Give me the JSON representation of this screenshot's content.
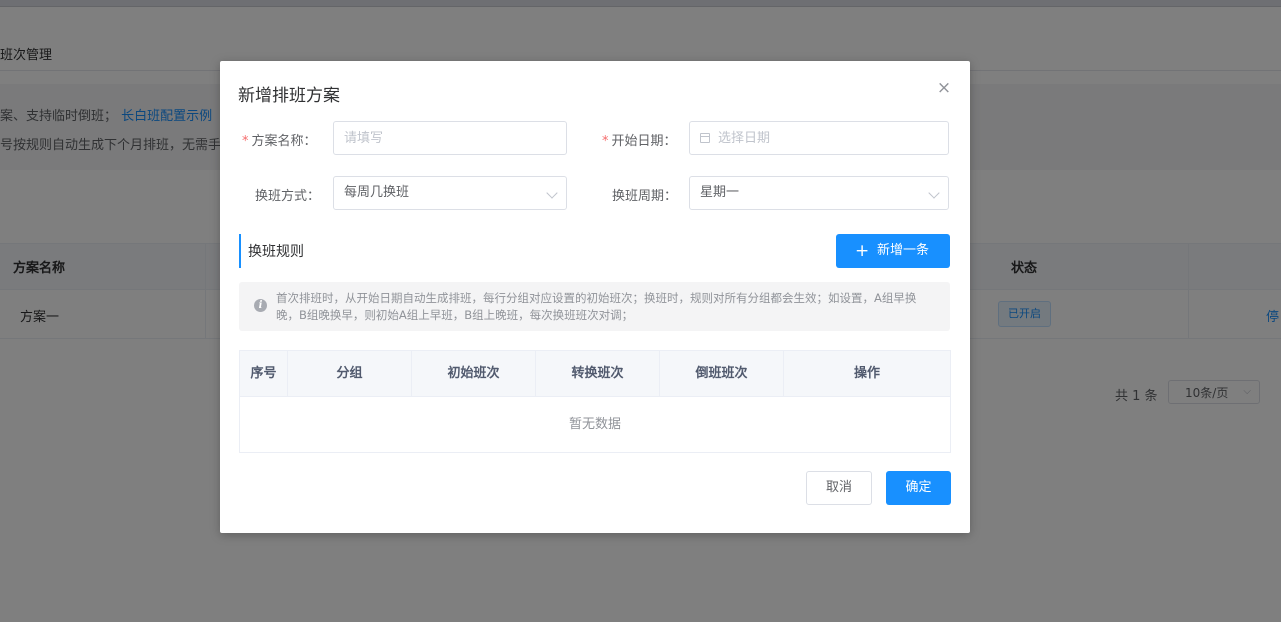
{
  "background": {
    "page_title": "班次管理",
    "tip": {
      "line1_prefix": "案、支持临时倒班；",
      "link": "长白班配置示例",
      "line2": "号按规则自动生成下个月排班，无需手"
    },
    "table": {
      "headers": [
        "方案名称",
        "状态"
      ],
      "rows": [
        {
          "name": "方案一",
          "status": "已开启",
          "action": "停"
        }
      ]
    },
    "pagination": {
      "total": "共 1 条",
      "page_size": "10条/页"
    }
  },
  "dialog": {
    "title": "新增排班方案",
    "close_icon": "close-icon",
    "form": {
      "plan_name": {
        "label": "方案名称：",
        "placeholder": "请填写",
        "value": "",
        "required": true
      },
      "start_date": {
        "label": "开始日期：",
        "placeholder": "选择日期",
        "value": "",
        "required": true,
        "icon": "calendar-icon"
      },
      "shift_mode": {
        "label": "换班方式：",
        "value": "每周几换班"
      },
      "shift_cycle": {
        "label": "换班周期：",
        "value": "星期一"
      }
    },
    "rules": {
      "section_title": "换班规则",
      "add_button": "新增一条",
      "tip": "首次排班时，从开始日期自动生成排班，每行分组对应设置的初始班次；换班时，规则对所有分组都会生效；如设置，A组早换晚，B组晚换早，则初始A组上早班，B组上晚班，每次换班班次对调；",
      "columns": [
        "序号",
        "分组",
        "初始班次",
        "转换班次",
        "倒班班次",
        "操作"
      ],
      "empty_text": "暂无数据"
    },
    "footer": {
      "cancel": "取消",
      "confirm": "确定"
    }
  },
  "colors": {
    "primary": "#1890ff",
    "required": "#f56c6c",
    "overlay": "rgba(0,0,0,0.5)"
  }
}
